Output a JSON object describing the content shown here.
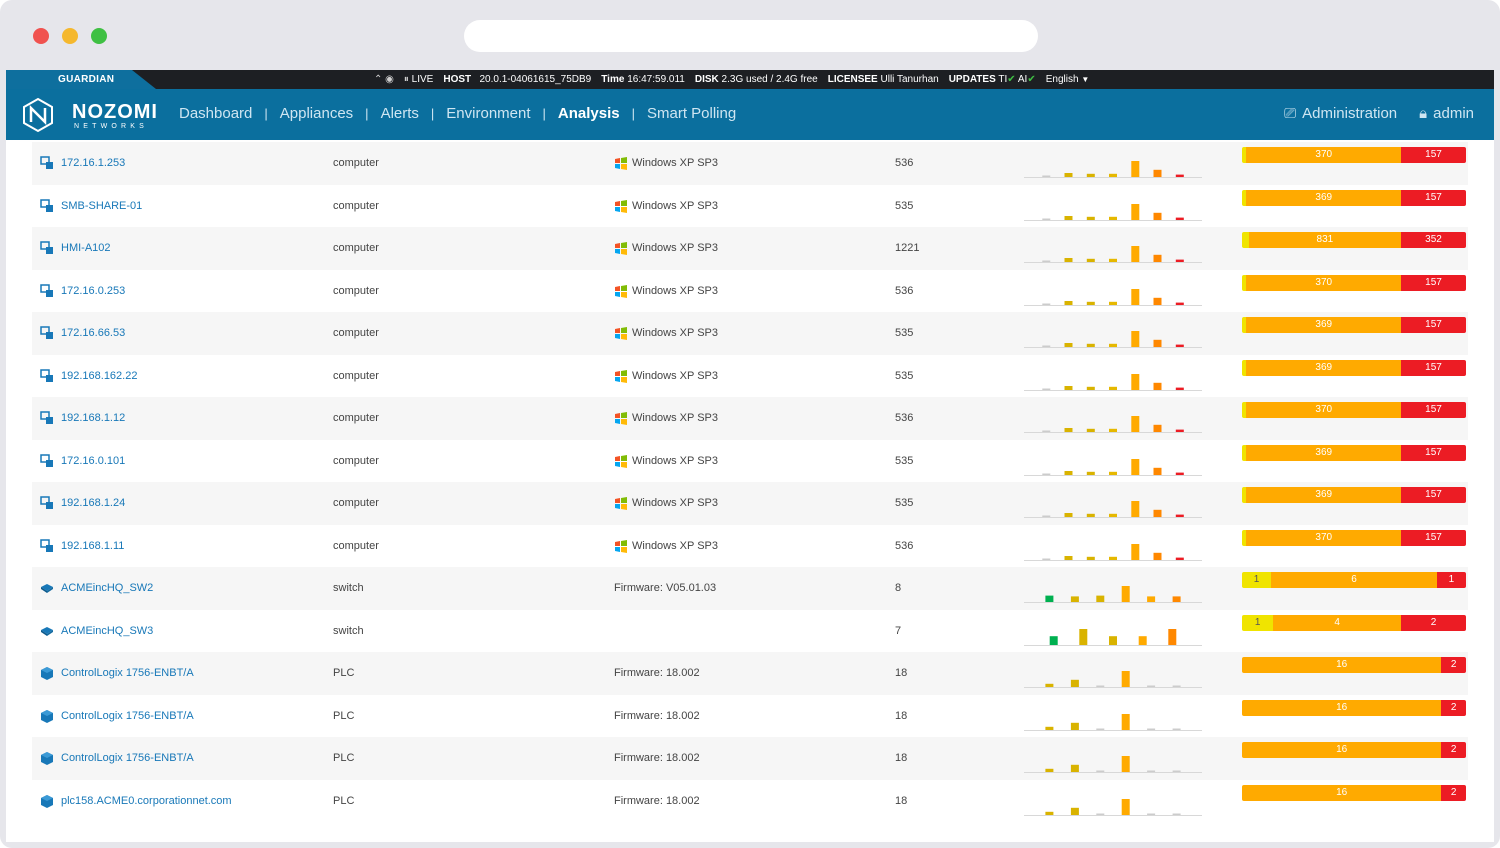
{
  "statusbar": {
    "product": "GUARDIAN",
    "live": "LIVE",
    "host_label": "HOST",
    "host_value": "20.0.1-04061615_75DB9",
    "time_label": "Time",
    "time_value": "16:47:59.011",
    "disk_label": "DISK",
    "disk_value": "2.3G used / 2.4G free",
    "licensee_label": "LICENSEE",
    "licensee_value": "Ulli Tanurhan",
    "updates_label": "UPDATES",
    "updates_ti": "TI",
    "updates_ai": "AI",
    "language": "English"
  },
  "nav": {
    "logo_main": "NOZOMI",
    "logo_sub": "NETWORKS",
    "items": [
      {
        "label": "Dashboard",
        "active": false
      },
      {
        "label": "Appliances",
        "active": false
      },
      {
        "label": "Alerts",
        "active": false
      },
      {
        "label": "Environment",
        "active": false
      },
      {
        "label": "Analysis",
        "active": true
      },
      {
        "label": "Smart Polling",
        "active": false
      }
    ],
    "administration": "Administration",
    "user": "admin"
  },
  "colors": {
    "accent": "#0b6f9e",
    "link": "#1878b8",
    "risk_low": "#f0e400",
    "risk_medium": "#ffaa00",
    "risk_high": "#ec1c24"
  },
  "rows": [
    {
      "name": "172.16.1.253",
      "type": "computer",
      "os": "Windows XP SP3",
      "count": "536",
      "icon": "computer-icon",
      "risk": [
        {
          "v": "",
          "f": 0.02,
          "c": "y"
        },
        {
          "v": "370",
          "f": 0.69,
          "c": "o"
        },
        {
          "v": "157",
          "f": 0.29,
          "c": "r"
        }
      ]
    },
    {
      "name": "SMB-SHARE-01",
      "type": "computer",
      "os": "Windows XP SP3",
      "count": "535",
      "icon": "computer-icon",
      "risk": [
        {
          "v": "",
          "f": 0.02,
          "c": "y"
        },
        {
          "v": "369",
          "f": 0.69,
          "c": "o"
        },
        {
          "v": "157",
          "f": 0.29,
          "c": "r"
        }
      ]
    },
    {
      "name": "HMI-A102",
      "type": "computer",
      "os": "Windows XP SP3",
      "count": "1221",
      "icon": "computer-icon",
      "risk": [
        {
          "v": "",
          "f": 0.03,
          "c": "y"
        },
        {
          "v": "831",
          "f": 0.68,
          "c": "o"
        },
        {
          "v": "352",
          "f": 0.29,
          "c": "r"
        }
      ]
    },
    {
      "name": "172.16.0.253",
      "type": "computer",
      "os": "Windows XP SP3",
      "count": "536",
      "icon": "computer-icon",
      "risk": [
        {
          "v": "",
          "f": 0.02,
          "c": "y"
        },
        {
          "v": "370",
          "f": 0.69,
          "c": "o"
        },
        {
          "v": "157",
          "f": 0.29,
          "c": "r"
        }
      ]
    },
    {
      "name": "172.16.66.53",
      "type": "computer",
      "os": "Windows XP SP3",
      "count": "535",
      "icon": "computer-icon",
      "risk": [
        {
          "v": "",
          "f": 0.02,
          "c": "y"
        },
        {
          "v": "369",
          "f": 0.69,
          "c": "o"
        },
        {
          "v": "157",
          "f": 0.29,
          "c": "r"
        }
      ]
    },
    {
      "name": "192.168.162.22",
      "type": "computer",
      "os": "Windows XP SP3",
      "count": "535",
      "icon": "computer-icon",
      "risk": [
        {
          "v": "",
          "f": 0.02,
          "c": "y"
        },
        {
          "v": "369",
          "f": 0.69,
          "c": "o"
        },
        {
          "v": "157",
          "f": 0.29,
          "c": "r"
        }
      ]
    },
    {
      "name": "192.168.1.12",
      "type": "computer",
      "os": "Windows XP SP3",
      "count": "536",
      "icon": "computer-icon",
      "risk": [
        {
          "v": "",
          "f": 0.02,
          "c": "y"
        },
        {
          "v": "370",
          "f": 0.69,
          "c": "o"
        },
        {
          "v": "157",
          "f": 0.29,
          "c": "r"
        }
      ]
    },
    {
      "name": "172.16.0.101",
      "type": "computer",
      "os": "Windows XP SP3",
      "count": "535",
      "icon": "computer-icon",
      "risk": [
        {
          "v": "",
          "f": 0.02,
          "c": "y"
        },
        {
          "v": "369",
          "f": 0.69,
          "c": "o"
        },
        {
          "v": "157",
          "f": 0.29,
          "c": "r"
        }
      ]
    },
    {
      "name": "192.168.1.24",
      "type": "computer",
      "os": "Windows XP SP3",
      "count": "535",
      "icon": "computer-icon",
      "risk": [
        {
          "v": "",
          "f": 0.02,
          "c": "y"
        },
        {
          "v": "369",
          "f": 0.69,
          "c": "o"
        },
        {
          "v": "157",
          "f": 0.29,
          "c": "r"
        }
      ]
    },
    {
      "name": "192.168.1.11",
      "type": "computer",
      "os": "Windows XP SP3",
      "count": "536",
      "icon": "computer-icon",
      "risk": [
        {
          "v": "",
          "f": 0.02,
          "c": "y"
        },
        {
          "v": "370",
          "f": 0.69,
          "c": "o"
        },
        {
          "v": "157",
          "f": 0.29,
          "c": "r"
        }
      ]
    },
    {
      "name": "ACMEincHQ_SW2",
      "type": "switch",
      "os": "Firmware: V05.01.03",
      "count": "8",
      "icon": "switch-icon",
      "risk": [
        {
          "v": "1",
          "f": 0.13,
          "c": "y"
        },
        {
          "v": "6",
          "f": 0.74,
          "c": "o"
        },
        {
          "v": "1",
          "f": 0.13,
          "c": "r"
        }
      ]
    },
    {
      "name": "ACMEincHQ_SW3",
      "type": "switch",
      "os": "",
      "count": "7",
      "icon": "switch-icon",
      "risk": [
        {
          "v": "1",
          "f": 0.14,
          "c": "y"
        },
        {
          "v": "4",
          "f": 0.57,
          "c": "o"
        },
        {
          "v": "2",
          "f": 0.29,
          "c": "r"
        }
      ]
    },
    {
      "name": "ControlLogix 1756-ENBT/A",
      "type": "PLC",
      "os": "Firmware: 18.002",
      "count": "18",
      "icon": "plc-icon",
      "risk": [
        {
          "v": "16",
          "f": 0.89,
          "c": "o"
        },
        {
          "v": "2",
          "f": 0.11,
          "c": "r"
        }
      ]
    },
    {
      "name": "ControlLogix 1756-ENBT/A",
      "type": "PLC",
      "os": "Firmware: 18.002",
      "count": "18",
      "icon": "plc-icon",
      "risk": [
        {
          "v": "16",
          "f": 0.89,
          "c": "o"
        },
        {
          "v": "2",
          "f": 0.11,
          "c": "r"
        }
      ]
    },
    {
      "name": "ControlLogix 1756-ENBT/A",
      "type": "PLC",
      "os": "Firmware: 18.002",
      "count": "18",
      "icon": "plc-icon",
      "risk": [
        {
          "v": "16",
          "f": 0.89,
          "c": "o"
        },
        {
          "v": "2",
          "f": 0.11,
          "c": "r"
        }
      ]
    },
    {
      "name": "plc158.ACME0.corporationnet.com",
      "type": "PLC",
      "os": "Firmware: 18.002",
      "count": "18",
      "icon": "plc-icon",
      "risk": [
        {
          "v": "16",
          "f": 0.89,
          "c": "o"
        },
        {
          "v": "2",
          "f": 0.11,
          "c": "r"
        }
      ]
    }
  ],
  "sparklines": {
    "computer": [
      {
        "h": 0.05,
        "c": "#cccccc"
      },
      {
        "h": 0.25,
        "c": "#d9b300"
      },
      {
        "h": 0.2,
        "c": "#d9b300"
      },
      {
        "h": 0.2,
        "c": "#e6b800"
      },
      {
        "h": 1.0,
        "c": "#ffaa00"
      },
      {
        "h": 0.45,
        "c": "#ff8800"
      },
      {
        "h": 0.15,
        "c": "#ec1c24"
      }
    ],
    "switch": [
      {
        "h": 0.4,
        "c": "#00b050"
      },
      {
        "h": 0.35,
        "c": "#d9b300"
      },
      {
        "h": 0.4,
        "c": "#d9b300"
      },
      {
        "h": 1.0,
        "c": "#ffaa00"
      },
      {
        "h": 0.35,
        "c": "#ffaa00"
      },
      {
        "h": 0.35,
        "c": "#ff8800"
      }
    ],
    "switch2": [
      {
        "h": 0.55,
        "c": "#00b050"
      },
      {
        "h": 1.0,
        "c": "#d9b300"
      },
      {
        "h": 0.55,
        "c": "#d9b300"
      },
      {
        "h": 0.55,
        "c": "#ffaa00"
      },
      {
        "h": 1.0,
        "c": "#ff8800"
      }
    ],
    "plc": [
      {
        "h": 0.2,
        "c": "#d9b300"
      },
      {
        "h": 0.45,
        "c": "#d9b300"
      },
      {
        "h": 0.05,
        "c": "#cccccc"
      },
      {
        "h": 1.0,
        "c": "#ffaa00"
      },
      {
        "h": 0.05,
        "c": "#cccccc"
      },
      {
        "h": 0.05,
        "c": "#cccccc"
      }
    ]
  }
}
